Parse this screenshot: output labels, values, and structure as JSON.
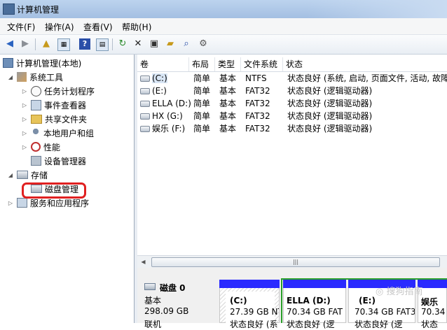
{
  "window": {
    "title": "计算机管理"
  },
  "menu": [
    "文件(F)",
    "操作(A)",
    "查看(V)",
    "帮助(H)"
  ],
  "toolbar": {
    "icons": [
      "back-arrow-icon",
      "forward-arrow-icon",
      "up-folder-icon",
      "show-tree-icon",
      "help-icon",
      "console-icon",
      "refresh-icon",
      "delete-icon",
      "properties-icon",
      "open-icon",
      "search-icon",
      "settings-icon"
    ]
  },
  "tree": {
    "root": "计算机管理(本地)",
    "system_tools": "系统工具",
    "task_scheduler": "任务计划程序",
    "event_viewer": "事件查看器",
    "shared_folders": "共享文件夹",
    "local_users": "本地用户和组",
    "performance": "性能",
    "device_manager": "设备管理器",
    "storage": "存储",
    "disk_management": "磁盘管理",
    "services": "服务和应用程序"
  },
  "volumes": {
    "headers": [
      "卷",
      "布局",
      "类型",
      "文件系统",
      "状态"
    ],
    "rows": [
      {
        "volume": "(C:)",
        "layout": "简单",
        "type": "基本",
        "fs": "NTFS",
        "status": "状态良好 (系统, 启动, 页面文件, 活动, 故障"
      },
      {
        "volume": "(E:)",
        "layout": "简单",
        "type": "基本",
        "fs": "FAT32",
        "status": "状态良好 (逻辑驱动器)"
      },
      {
        "volume": "ELLA (D:)",
        "layout": "简单",
        "type": "基本",
        "fs": "FAT32",
        "status": "状态良好 (逻辑驱动器)"
      },
      {
        "volume": "HX (G:)",
        "layout": "简单",
        "type": "基本",
        "fs": "FAT32",
        "status": "状态良好 (逻辑驱动器)"
      },
      {
        "volume": "娱乐 (F:)",
        "layout": "简单",
        "type": "基本",
        "fs": "FAT32",
        "status": "状态良好 (逻辑驱动器)"
      }
    ]
  },
  "disk": {
    "name": "磁盘 0",
    "type": "基本",
    "size": "298.09 GB",
    "status": "联机",
    "partitions": [
      {
        "label": "(C:)",
        "size": "27.39 GB NT",
        "status": "状态良好 (系"
      },
      {
        "label": "ELLA  (D:)",
        "size": "70.34 GB FAT",
        "status": "状态良好 (逻"
      },
      {
        "label": "(E:)",
        "size": "70.34 GB FAT3",
        "status": "状态良好 (逻"
      },
      {
        "label": "娱乐",
        "size": "70.34",
        "status": "状态"
      }
    ]
  },
  "watermark": "搜狗指南",
  "colors": {
    "partition_bar": "#2a2aff",
    "highlight": "#e02020",
    "extended_border": "#2aa02a"
  }
}
